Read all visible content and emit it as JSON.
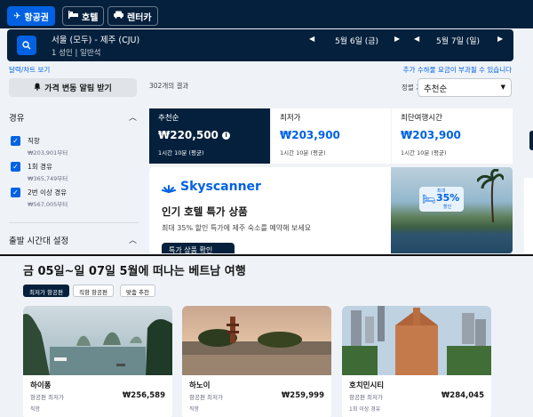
{
  "nav": {
    "tabs": [
      {
        "label": "항공권",
        "icon": "plane-icon",
        "active": true
      },
      {
        "label": "호텔",
        "icon": "bed-icon",
        "active": false
      },
      {
        "label": "렌터카",
        "icon": "car-icon",
        "active": false
      }
    ]
  },
  "search": {
    "route": "서울 (모두) - 제주 (CJU)",
    "passengers": "1 성인 | 일반석",
    "depart_date": "5월 6일 (금)",
    "return_date": "5월 7일 (일)"
  },
  "links": {
    "left": "달력/차트 보기",
    "right": "추가 수하물 요금이 부과될 수 있습니다"
  },
  "filters": {
    "price_alert_label": "가격 변동 알림 받기",
    "stops_heading": "경유",
    "stops": [
      {
        "label": "직항",
        "price": "₩203,901부터"
      },
      {
        "label": "1회 경유",
        "price": "₩365,749부터"
      },
      {
        "label": "2번 이상 경유",
        "price": "₩567,005부터"
      }
    ],
    "departure_heading": "출발 시간대 설정"
  },
  "results": {
    "count": "302개의 결과",
    "sort_label": "정렬 기준",
    "sort_value": "추천순",
    "sort_cards": [
      {
        "title": "추천순",
        "price": "₩220,500",
        "duration": "1시간 10분 (평균)",
        "active": true
      },
      {
        "title": "최저가",
        "price": "₩203,900",
        "duration": "1시간 10분 (평균)",
        "active": false
      },
      {
        "title": "최단여행시간",
        "price": "₩203,900",
        "duration": "1시간 10분 (평균)",
        "active": false
      }
    ]
  },
  "promo": {
    "brand": "Skyscanner",
    "heading": "인기 호텔 특가 상품",
    "subtext": "최대 35% 할인 특가에 제주 숙소를 예약해 보세요",
    "button": "특가 상품 확인",
    "badge_top": "최대",
    "badge_pct": "35%",
    "badge_bottom": "할인"
  },
  "section2": {
    "title": "금 05일~일 07일 5월에 떠나는 베트남 여행",
    "chips": [
      {
        "label": "최저가 항공편",
        "active": true
      },
      {
        "label": "직항 항공편",
        "active": false
      },
      {
        "label": "맞춤 추천",
        "active": false
      }
    ],
    "destinations": [
      {
        "name": "하이퐁",
        "sub": "항공편 최저가",
        "price": "₩256,589",
        "type": "직항"
      },
      {
        "name": "하노이",
        "sub": "항공편 최저가",
        "price": "₩259,999",
        "type": "직항"
      },
      {
        "name": "호치민시티",
        "sub": "항공편 최저가",
        "price": "₩284,045",
        "type": "1회 이상 경유"
      }
    ]
  },
  "colors": {
    "navy": "#05203c",
    "accent_blue": "#0062e3",
    "background": "#eff3f8"
  }
}
